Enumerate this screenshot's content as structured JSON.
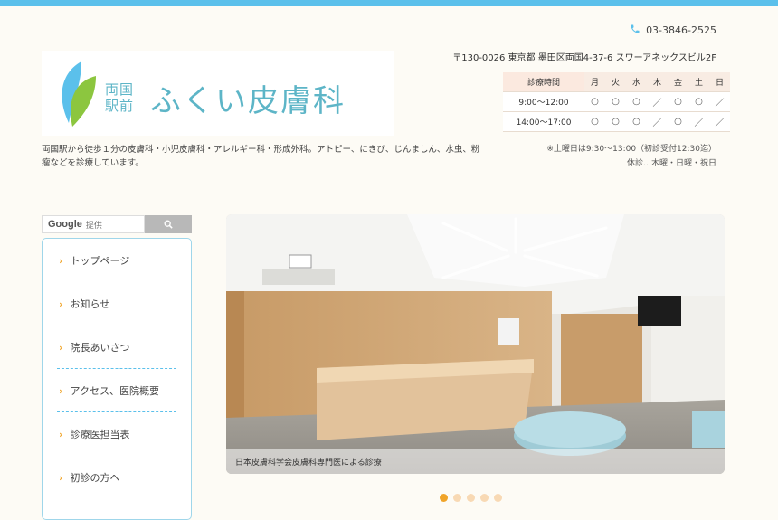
{
  "header": {
    "phone": "03-3846-2525",
    "address": "〒130-0026 東京都 墨田区両国4-37-6 スワーアネックスビル2F",
    "logo": {
      "area_line1": "両国",
      "area_line2": "駅前",
      "clinic_name": "ふくい皮膚科"
    },
    "intro": "両国駅から徒歩１分の皮膚科・小児皮膚科・アレルギー科・形成外科。アトピー、にきび、じんましん、水虫、粉瘤などを診療しています。"
  },
  "hours": {
    "header": [
      "診療時間",
      "月",
      "火",
      "水",
      "木",
      "金",
      "土",
      "日"
    ],
    "rows": [
      {
        "time": "9:00～12:00",
        "marks": [
          "○",
          "○",
          "○",
          "／",
          "○",
          "○",
          "／"
        ]
      },
      {
        "time": "14:00～17:00",
        "marks": [
          "○",
          "○",
          "○",
          "／",
          "○",
          "／",
          "／"
        ]
      }
    ],
    "note1": "※土曜日は9:30～13:00（初診受付12:30迄）",
    "note2": "休診…木曜・日曜・祝日"
  },
  "search": {
    "google_label": "Google",
    "placeholder": "提供"
  },
  "menu": {
    "items": [
      {
        "label": "トップページ"
      },
      {
        "label": "お知らせ"
      },
      {
        "label": "院長あいさつ"
      },
      {
        "label": "アクセス、医院概要"
      },
      {
        "label": "診療医担当表"
      },
      {
        "label": "初診の方へ"
      }
    ]
  },
  "hero": {
    "caption": "日本皮膚科学会皮膚科専門医による診療",
    "slide_count": 5,
    "active_slide": 1
  },
  "colors": {
    "accent_blue": "#5bc0eb",
    "accent_orange": "#f0a429",
    "logo_teal": "#5db5c7",
    "leaf_green": "#8cc63f"
  }
}
